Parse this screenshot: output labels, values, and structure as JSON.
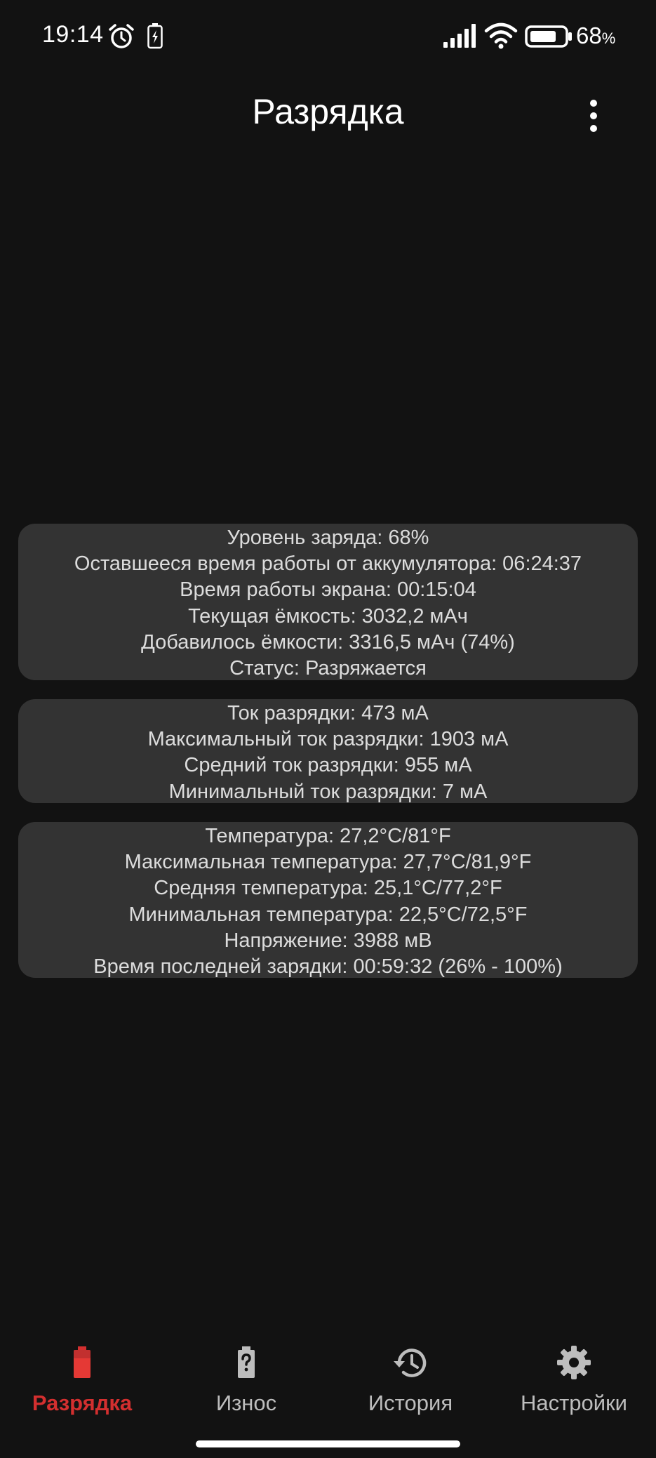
{
  "status_bar": {
    "time": "19:14",
    "battery_percent": "68",
    "percent_sign": "%"
  },
  "app_bar": {
    "title": "Разрядка"
  },
  "cards": {
    "battery": {
      "lines": [
        "Уровень заряда: 68%",
        "Оставшееся время работы от аккумулятора: 06:24:37",
        "Время работы экрана: 00:15:04",
        "Текущая ёмкость: 3032,2 мАч",
        "Добавилось ёмкости: 3316,5 мАч (74%)",
        "Статус: Разряжается"
      ]
    },
    "current": {
      "lines": [
        "Ток разрядки: 473 мА",
        "Максимальный ток разрядки: 1903 мА",
        "Средний ток разрядки: 955 мА",
        "Минимальный ток разрядки: 7 мА"
      ]
    },
    "temperature": {
      "lines": [
        "Температура: 27,2°C/81°F",
        "Максимальная температура: 27,7°C/81,9°F",
        "Средняя температура: 25,1°C/77,2°F",
        "Минимальная температура: 22,5°C/72,5°F",
        "Напряжение: 3988 мВ",
        "Время последней зарядки: 00:59:32 (26% - 100%)"
      ]
    }
  },
  "bottom_nav": {
    "items": [
      {
        "label": "Разрядка",
        "icon": "battery-discharge-icon",
        "active": true
      },
      {
        "label": "Износ",
        "icon": "battery-unknown-icon",
        "active": false
      },
      {
        "label": "История",
        "icon": "history-icon",
        "active": false
      },
      {
        "label": "Настройки",
        "icon": "gear-icon",
        "active": false
      }
    ]
  },
  "colors": {
    "background": "#121212",
    "card": "#333333",
    "card_text": "#dcdcdc",
    "accent": "#d32f2f",
    "nav_inactive": "#bdbdbd"
  }
}
